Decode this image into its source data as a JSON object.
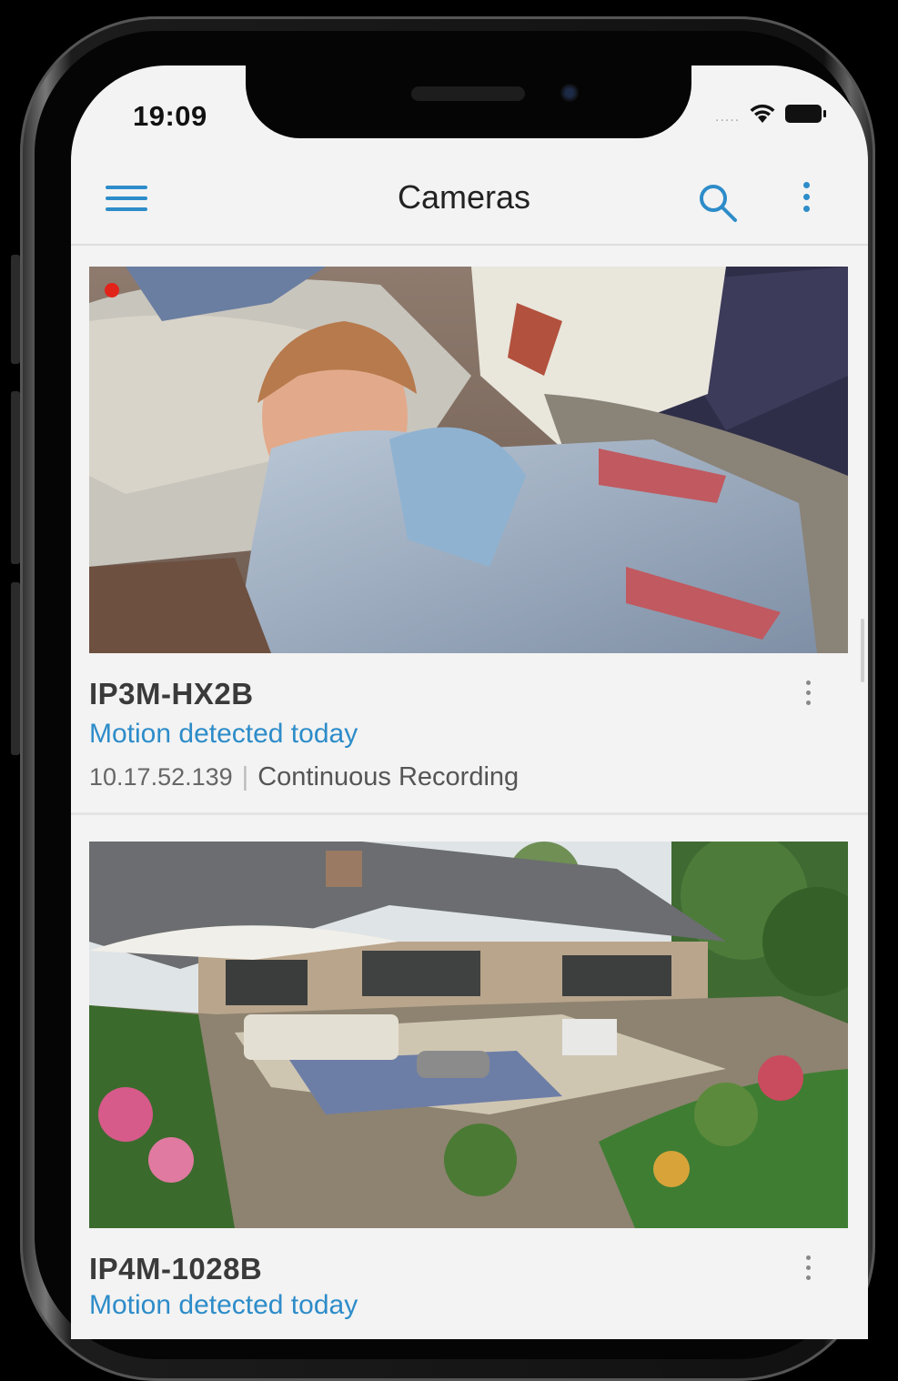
{
  "status_bar": {
    "time": "19:09",
    "signal": "....."
  },
  "app_bar": {
    "title": "Cameras"
  },
  "cameras": [
    {
      "name": "IP3M-HX2B",
      "status": "Motion detected today",
      "ip": "10.17.52.139",
      "separator": "|",
      "recording_mode": "Continuous Recording",
      "recording": true
    },
    {
      "name": "IP4M-1028B",
      "status": "Motion detected today"
    }
  ],
  "colors": {
    "accent": "#2d8cc9",
    "record": "#e2231a",
    "background": "#f3f3f3"
  },
  "icons": [
    "menu-icon",
    "search-icon",
    "more-vertical-icon",
    "wifi-icon",
    "battery-icon"
  ]
}
